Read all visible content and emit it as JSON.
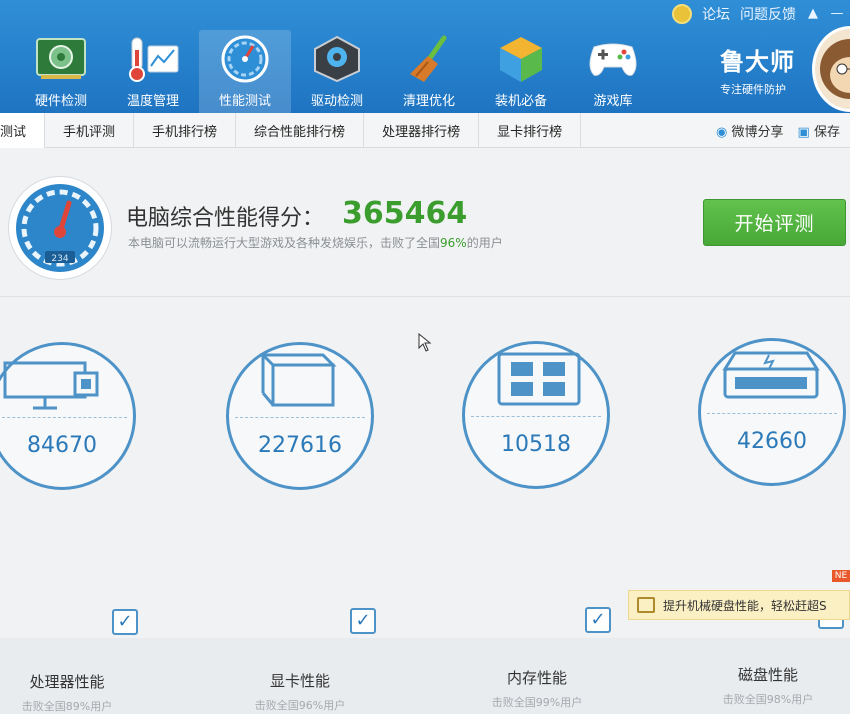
{
  "header": {
    "links": [
      "论坛",
      "问题反馈"
    ],
    "brand": {
      "name": "鲁大师",
      "slogan": "专注硬件防护"
    }
  },
  "nav": [
    {
      "label": "硬件检测",
      "icon": "hardware-board-icon"
    },
    {
      "label": "温度管理",
      "icon": "thermometer-icon"
    },
    {
      "label": "性能测试",
      "icon": "speedometer-icon",
      "active": true
    },
    {
      "label": "驱动检测",
      "icon": "gear-box-icon"
    },
    {
      "label": "清理优化",
      "icon": "broom-icon"
    },
    {
      "label": "装机必备",
      "icon": "cube-icon"
    },
    {
      "label": "游戏库",
      "icon": "gamepad-icon"
    }
  ],
  "subtabs": [
    "测试",
    "手机评测",
    "手机排行榜",
    "综合性能排行榜",
    "处理器排行榜",
    "显卡排行榜"
  ],
  "share": {
    "weibo": "微博分享",
    "save": "保存"
  },
  "score": {
    "title": "电脑综合性能得分：",
    "value": "365464",
    "desc_prefix": "本电脑可以流畅运行大型游戏及各种发烧娱乐，击败了全国",
    "desc_pct": "96%",
    "desc_suffix": "的用户",
    "gauge_readout": "234"
  },
  "start_button": "开始评测",
  "metrics": [
    {
      "label": "处理器性能",
      "value": "84670",
      "sub": "击败全国89%用户",
      "icon": "monitor-cpu-icon"
    },
    {
      "label": "显卡性能",
      "value": "227616",
      "sub": "击败全国96%用户",
      "icon": "graphics-card-icon"
    },
    {
      "label": "内存性能",
      "value": "10518",
      "sub": "击败全国99%用户",
      "icon": "memory-chip-icon"
    },
    {
      "label": "磁盘性能",
      "value": "42660",
      "sub": "击败全国98%用户",
      "icon": "disk-drive-icon"
    }
  ],
  "promo": {
    "text": "提升机械硬盘性能，轻松赶超S",
    "badge": "NE"
  },
  "colors": {
    "header_blue": "#2080c8",
    "score_green": "#3b9d2e",
    "metric_blue": "#4e93c8"
  }
}
